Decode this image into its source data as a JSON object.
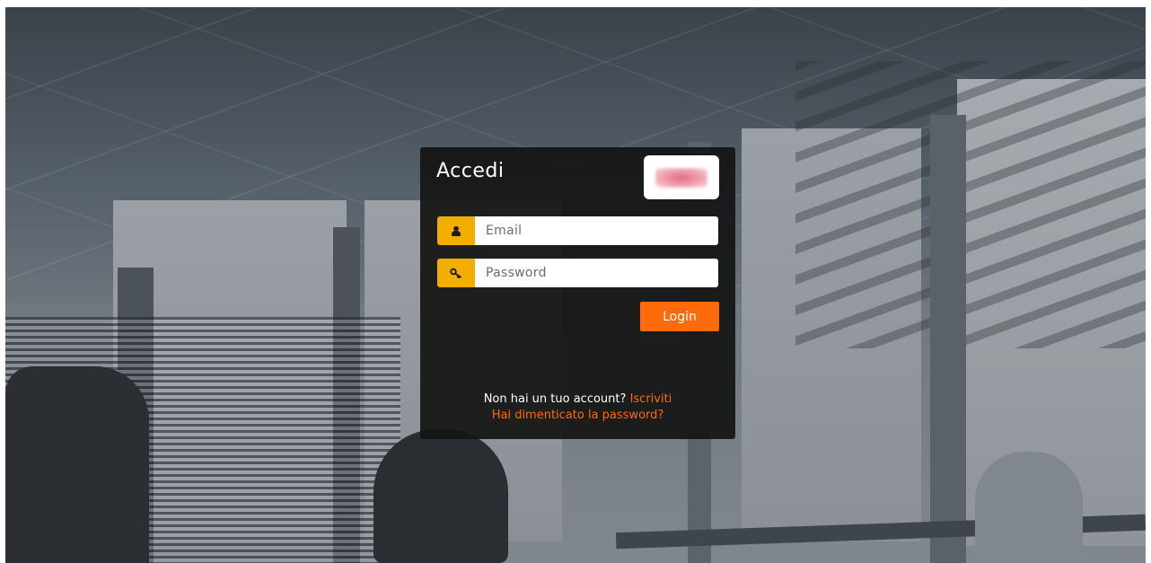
{
  "login": {
    "title": "Accedi",
    "email_placeholder": "Email",
    "password_placeholder": "Password",
    "login_label": "Login",
    "no_account_text": "Non hai un tuo account?",
    "signup_link": "Iscriviti",
    "forgot_link": "Hai dimenticato la password?"
  },
  "icons": {
    "email": "user-icon",
    "password": "key-icon"
  },
  "colors": {
    "accent": "#ff6a0a",
    "addon": "#f3ae00",
    "card": "#141414"
  }
}
